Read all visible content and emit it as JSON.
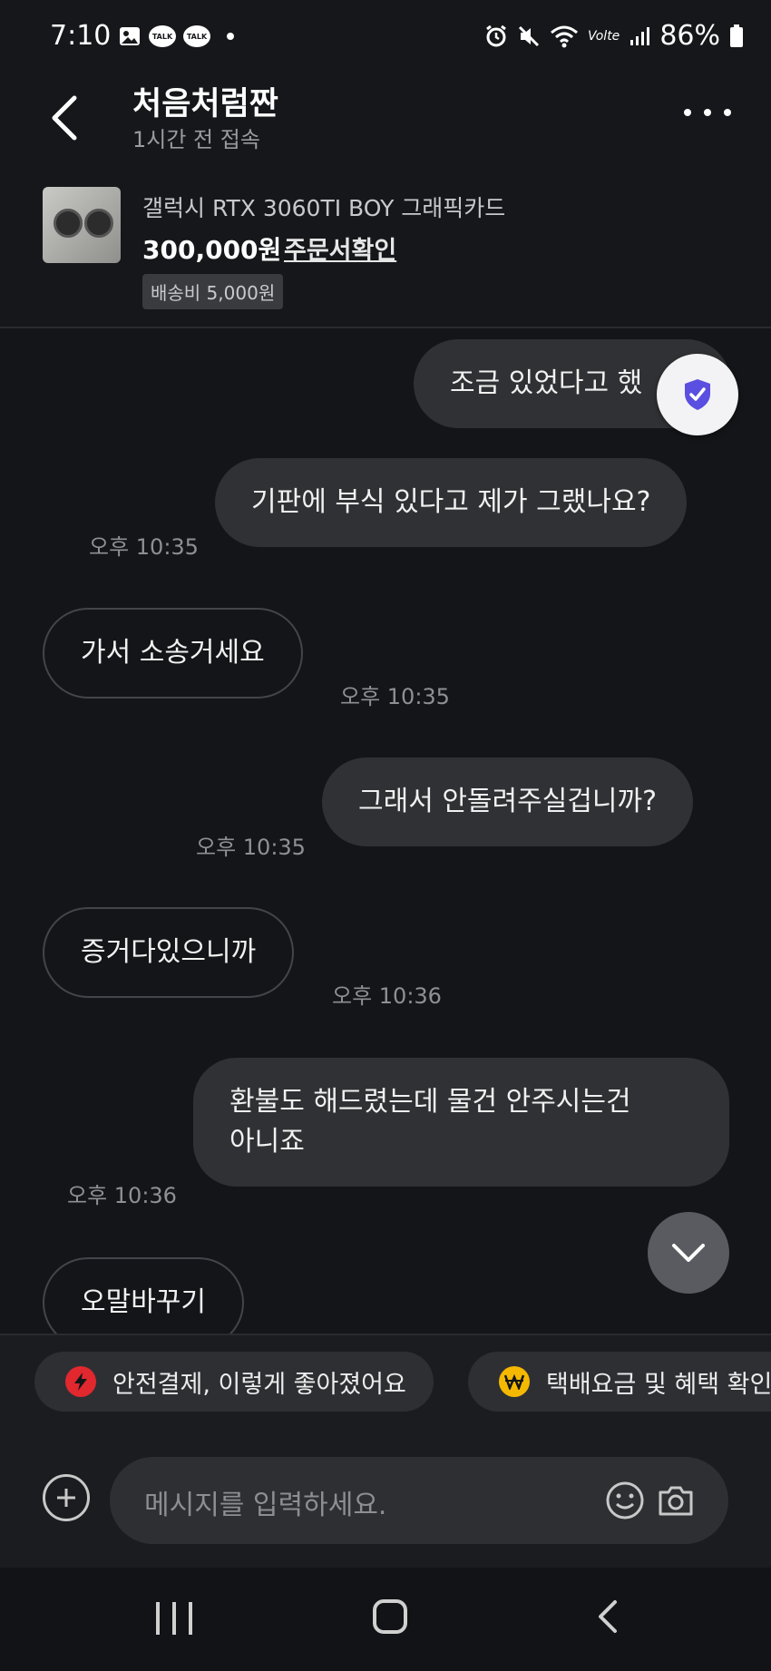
{
  "status_bar": {
    "time": "7:10",
    "talk_label": "TALK",
    "network_label": "Volte",
    "battery": "86%"
  },
  "header": {
    "name": "처음처럼짠",
    "subtitle": "1시간 전 접속"
  },
  "product": {
    "title": "갤럭시 RTX 3060TI BOY 그래픽카드",
    "price": "300,000원",
    "order_link": "주문서확인",
    "shipping": "배송비 5,000원"
  },
  "messages": [
    {
      "side": "mine",
      "text": "조금 있었다고 했",
      "time": ""
    },
    {
      "side": "mine",
      "text": "기판에 부식 있다고 제가 그랬나요?",
      "time": "오후 10:35"
    },
    {
      "side": "theirs",
      "text": "가서 소송거세요",
      "time": "오후 10:35"
    },
    {
      "side": "mine",
      "text": "그래서 안돌려주실겁니까?",
      "time": "오후 10:35"
    },
    {
      "side": "theirs",
      "text": "증거다있으니까",
      "time": "오후 10:36"
    },
    {
      "side": "mine",
      "text_line1": "환불도 해드렸는데 물건 안주시는건",
      "text_line2": "아니죠",
      "time": "오후 10:36"
    },
    {
      "side": "theirs",
      "text": "오말바꾸기",
      "time": ""
    }
  ],
  "chips": [
    {
      "label": "안전결제, 이렇게 좋아졌어요",
      "icon": "lightning-icon",
      "color": "#e0282e"
    },
    {
      "label": "택배요금 및 혜택 확인",
      "icon": "won-icon",
      "color": "#f5b800"
    }
  ],
  "input": {
    "placeholder": "메시지를 입력하세요."
  },
  "colors": {
    "shield": "#5a4fe0",
    "bubble_mine": "#303134",
    "background": "#141518"
  }
}
